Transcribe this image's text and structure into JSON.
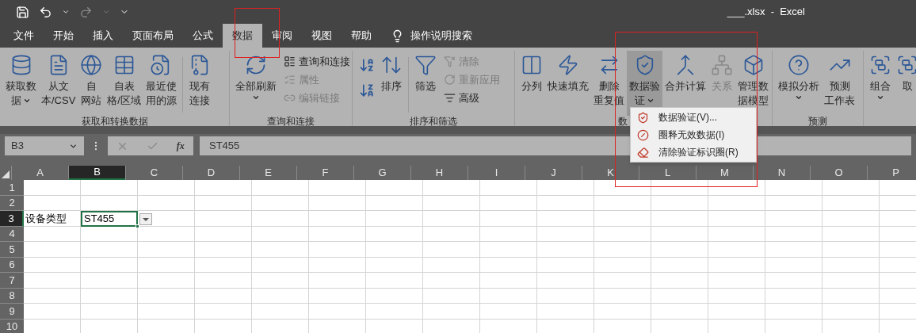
{
  "window": {
    "title": "___.xlsx  -  Excel"
  },
  "tabs": [
    {
      "label": "文件",
      "selected": false
    },
    {
      "label": "开始",
      "selected": false
    },
    {
      "label": "插入",
      "selected": false
    },
    {
      "label": "页面布局",
      "selected": false
    },
    {
      "label": "公式",
      "selected": false
    },
    {
      "label": "数据",
      "selected": true
    },
    {
      "label": "审阅",
      "selected": false
    },
    {
      "label": "视图",
      "selected": false
    },
    {
      "label": "帮助",
      "selected": false
    }
  ],
  "tell_me": {
    "label": "操作说明搜索"
  },
  "ribbon": {
    "groups": [
      {
        "label": "获取和转换数据",
        "items": [
          {
            "kind": "large",
            "lines": [
              "获取数",
              "据"
            ],
            "dropdown": true,
            "disabled": false,
            "pressed": false
          },
          {
            "kind": "large",
            "lines": [
              "从文",
              "本/CSV"
            ],
            "dropdown": false,
            "disabled": false,
            "pressed": false
          },
          {
            "kind": "large",
            "lines": [
              "自",
              "网站"
            ],
            "dropdown": false,
            "disabled": false,
            "pressed": false
          },
          {
            "kind": "large",
            "lines": [
              "自表",
              "格/区域"
            ],
            "dropdown": false,
            "disabled": false,
            "pressed": false
          },
          {
            "kind": "large",
            "lines": [
              "最近使",
              "用的源"
            ],
            "dropdown": false,
            "disabled": false,
            "pressed": false
          },
          {
            "kind": "separator"
          },
          {
            "kind": "large",
            "lines": [
              "现有",
              "连接"
            ],
            "dropdown": false,
            "disabled": false,
            "pressed": false
          }
        ]
      },
      {
        "label": "查询和连接",
        "items": [
          {
            "kind": "large",
            "lines": [
              "全部刷新"
            ],
            "dropdown": true,
            "disabled": false,
            "pressed": false
          },
          {
            "kind": "stack",
            "items": [
              {
                "label": "查询和连接",
                "disabled": false
              },
              {
                "label": "属性",
                "disabled": true
              },
              {
                "label": "编辑链接",
                "disabled": true
              }
            ]
          }
        ]
      },
      {
        "label": "排序和筛选",
        "items": [
          {
            "kind": "sort_icons"
          },
          {
            "kind": "large",
            "lines": [
              "排序"
            ],
            "dropdown": false,
            "disabled": false,
            "pressed": false
          },
          {
            "kind": "separator"
          },
          {
            "kind": "large",
            "lines": [
              "筛选"
            ],
            "dropdown": false,
            "disabled": false,
            "pressed": false
          },
          {
            "kind": "stack",
            "items": [
              {
                "label": "清除",
                "disabled": true
              },
              {
                "label": "重新应用",
                "disabled": true
              },
              {
                "label": "高级",
                "disabled": false
              }
            ]
          }
        ]
      },
      {
        "label": "数",
        "items": [
          {
            "kind": "large",
            "lines": [
              "分列"
            ],
            "dropdown": false,
            "disabled": false,
            "pressed": false
          },
          {
            "kind": "large",
            "lines": [
              "快速填充"
            ],
            "dropdown": false,
            "disabled": false,
            "pressed": false
          },
          {
            "kind": "large",
            "lines": [
              "删除",
              "重复值"
            ],
            "dropdown": false,
            "disabled": false,
            "pressed": false
          },
          {
            "kind": "large",
            "lines": [
              "数据验",
              "证"
            ],
            "dropdown": true,
            "disabled": false,
            "pressed": true
          },
          {
            "kind": "large",
            "lines": [
              "合并计算"
            ],
            "dropdown": false,
            "disabled": false,
            "pressed": false
          },
          {
            "kind": "large",
            "lines": [
              "关系"
            ],
            "dropdown": false,
            "disabled": true,
            "pressed": false
          },
          {
            "kind": "large",
            "lines": [
              "管理数",
              "据模型"
            ],
            "dropdown": false,
            "disabled": false,
            "pressed": false
          }
        ]
      },
      {
        "label": "预测",
        "items": [
          {
            "kind": "large",
            "lines": [
              "模拟分析"
            ],
            "dropdown": true,
            "disabled": false,
            "pressed": false
          },
          {
            "kind": "large",
            "lines": [
              "预测",
              "工作表"
            ],
            "dropdown": false,
            "disabled": false,
            "pressed": false
          }
        ]
      },
      {
        "items": [
          {
            "kind": "large",
            "lines": [
              "组合"
            ],
            "dropdown": true,
            "disabled": false,
            "pressed": false
          },
          {
            "kind": "large",
            "lines": [
              "取"
            ],
            "dropdown": false,
            "disabled": false,
            "pressed": false
          }
        ]
      }
    ]
  },
  "dropdown_menu": {
    "items": [
      {
        "label": "数据验证(V)..."
      },
      {
        "label": "圈释无效数据(I)"
      },
      {
        "label": "清除验证标识圈(R)"
      }
    ]
  },
  "formula_bar": {
    "name_box": "B3",
    "function_label": "fx",
    "value": "ST455"
  },
  "sheet": {
    "columns": [
      {
        "label": "A",
        "selected": false
      },
      {
        "label": "B",
        "selected": true
      },
      {
        "label": "C",
        "selected": false
      },
      {
        "label": "D",
        "selected": false
      },
      {
        "label": "E",
        "selected": false
      },
      {
        "label": "F",
        "selected": false
      },
      {
        "label": "G",
        "selected": false
      },
      {
        "label": "H",
        "selected": false
      },
      {
        "label": "I",
        "selected": false
      },
      {
        "label": "J",
        "selected": false
      },
      {
        "label": "K",
        "selected": false
      },
      {
        "label": "L",
        "selected": false
      },
      {
        "label": "M",
        "selected": false
      },
      {
        "label": "N",
        "selected": false
      },
      {
        "label": "O",
        "selected": false
      },
      {
        "label": "P",
        "selected": false
      }
    ],
    "rows": [
      {
        "label": "1",
        "selected": false,
        "cells": []
      },
      {
        "label": "2",
        "selected": false,
        "cells": []
      },
      {
        "label": "3",
        "selected": true,
        "cells": [
          {
            "text": "设备类型",
            "selected": false
          },
          {
            "text": "ST455",
            "selected": true,
            "dropdown": true
          }
        ]
      },
      {
        "label": "4",
        "selected": false,
        "cells": []
      },
      {
        "label": "5",
        "selected": false,
        "cells": []
      },
      {
        "label": "6",
        "selected": false,
        "cells": []
      },
      {
        "label": "7",
        "selected": false,
        "cells": []
      },
      {
        "label": "8",
        "selected": false,
        "cells": []
      },
      {
        "label": "9",
        "selected": false,
        "cells": []
      },
      {
        "label": "10",
        "selected": false,
        "cells": []
      }
    ]
  }
}
